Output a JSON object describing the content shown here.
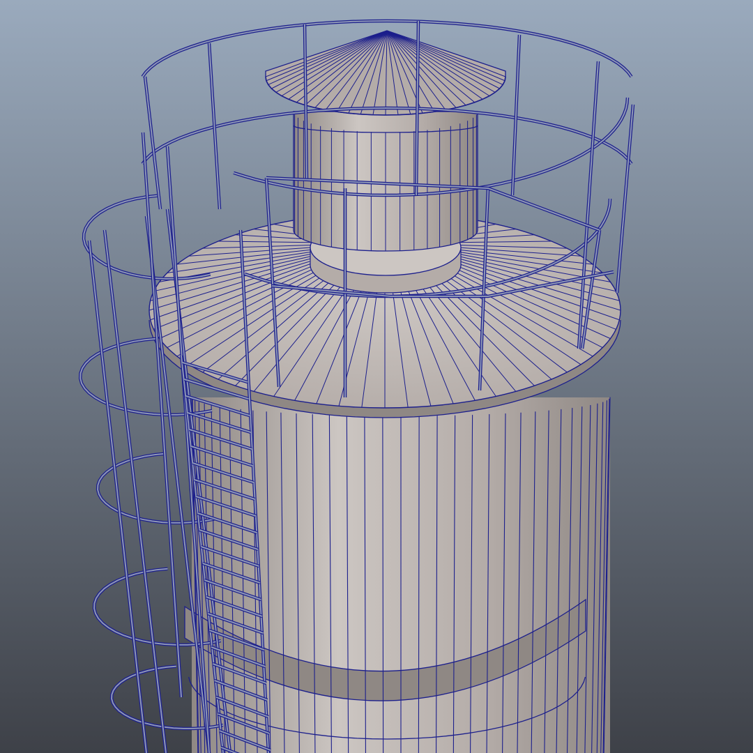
{
  "viewport": {
    "name": "3d-viewport",
    "background_top": "#9aaabd",
    "background_bottom": "#3e4148"
  },
  "model": {
    "subject": "silo-tower",
    "view_mode": "wireframe-on-shaded",
    "wire_color": "#1c1f8c",
    "surface_color": "#b4aca8",
    "surface_shadow": "#8f8884",
    "surface_light": "#ccc6c2",
    "parts": [
      "silo-body",
      "platform-deck",
      "turret",
      "cone-roof",
      "guard-railing",
      "access-ladder",
      "safety-cage"
    ]
  }
}
